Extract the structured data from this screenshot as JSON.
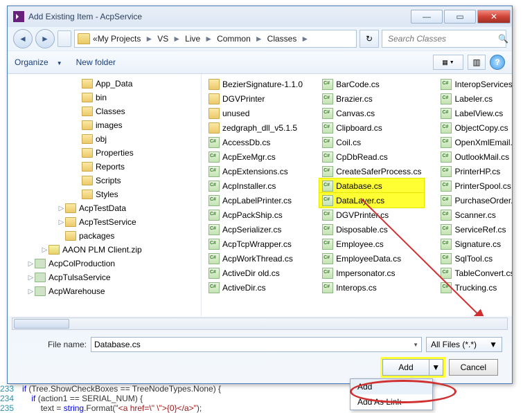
{
  "title": "Add Existing Item - AcpService",
  "breadcrumb": [
    "My Projects",
    "VS",
    "Live",
    "Common",
    "Classes"
  ],
  "search_placeholder": "Search Classes",
  "toolbar": {
    "organize": "Organize",
    "newfolder": "New folder"
  },
  "tree": [
    {
      "d": 3,
      "t": "App_Data"
    },
    {
      "d": 3,
      "t": "bin"
    },
    {
      "d": 3,
      "t": "Classes"
    },
    {
      "d": 3,
      "t": "images"
    },
    {
      "d": 3,
      "t": "obj"
    },
    {
      "d": 3,
      "t": "Properties"
    },
    {
      "d": 3,
      "t": "Reports"
    },
    {
      "d": 3,
      "t": "Scripts"
    },
    {
      "d": 3,
      "t": "Styles"
    },
    {
      "d": 2,
      "t": "AcpTestData",
      "tw": "▷"
    },
    {
      "d": 2,
      "t": "AcpTestService",
      "tw": "▷"
    },
    {
      "d": 2,
      "t": "packages"
    },
    {
      "d": 1,
      "t": "AAON PLM Client.zip",
      "ico": "zip",
      "tw": "▷"
    },
    {
      "d": 0,
      "t": "AcpColProduction",
      "ico": "svc",
      "tw": "▷"
    },
    {
      "d": 0,
      "t": "AcpTulsaService",
      "ico": "svc",
      "tw": "▷"
    },
    {
      "d": 0,
      "t": "AcpWarehouse",
      "ico": "svc",
      "tw": "▷"
    }
  ],
  "files": {
    "col1": [
      {
        "n": "BezierSignature-1.1.0",
        "k": "fldr"
      },
      {
        "n": "DGVPrinter",
        "k": "fldr"
      },
      {
        "n": "unused",
        "k": "fldr"
      },
      {
        "n": "zedgraph_dll_v5.1.5",
        "k": "fldr"
      },
      {
        "n": "AccessDb.cs",
        "k": "cs"
      },
      {
        "n": "AcpExeMgr.cs",
        "k": "cs"
      },
      {
        "n": "AcpExtensions.cs",
        "k": "cs"
      },
      {
        "n": "AcpInstaller.cs",
        "k": "cs"
      },
      {
        "n": "AcpLabelPrinter.cs",
        "k": "cs"
      },
      {
        "n": "AcpPackShip.cs",
        "k": "cs"
      },
      {
        "n": "AcpSerializer.cs",
        "k": "cs"
      },
      {
        "n": "AcpTcpWrapper.cs",
        "k": "cs"
      },
      {
        "n": "AcpWorkThread.cs",
        "k": "cs"
      },
      {
        "n": "ActiveDir old.cs",
        "k": "cs"
      },
      {
        "n": "ActiveDir.cs",
        "k": "cs"
      }
    ],
    "col2": [
      {
        "n": "BarCode.cs",
        "k": "cs"
      },
      {
        "n": "Brazier.cs",
        "k": "cs"
      },
      {
        "n": "Canvas.cs",
        "k": "cs"
      },
      {
        "n": "Clipboard.cs",
        "k": "cs"
      },
      {
        "n": "Coil.cs",
        "k": "cs"
      },
      {
        "n": "CpDbRead.cs",
        "k": "cs"
      },
      {
        "n": "CreateSaferProcess.cs",
        "k": "cs"
      },
      {
        "n": "Database.cs",
        "k": "cs",
        "hl": true
      },
      {
        "n": "DataLayer.cs",
        "k": "cs",
        "hl": true
      },
      {
        "n": "DGVPrinter.cs",
        "k": "cs"
      },
      {
        "n": "Disposable.cs",
        "k": "cs"
      },
      {
        "n": "Employee.cs",
        "k": "cs"
      },
      {
        "n": "EmployeeData.cs",
        "k": "cs"
      },
      {
        "n": "Impersonator.cs",
        "k": "cs"
      },
      {
        "n": "Interops.cs",
        "k": "cs"
      }
    ],
    "col3": [
      {
        "n": "InteropServices.cs",
        "k": "cs"
      },
      {
        "n": "Labeler.cs",
        "k": "cs"
      },
      {
        "n": "LabelView.cs",
        "k": "cs"
      },
      {
        "n": "ObjectCopy.cs",
        "k": "cs"
      },
      {
        "n": "OpenXmlEmail.cs",
        "k": "cs"
      },
      {
        "n": "OutlookMail.cs",
        "k": "cs"
      },
      {
        "n": "PrinterHP.cs",
        "k": "cs"
      },
      {
        "n": "PrinterSpool.cs",
        "k": "cs"
      },
      {
        "n": "PurchaseOrder.cs",
        "k": "cs"
      },
      {
        "n": "Scanner.cs",
        "k": "cs"
      },
      {
        "n": "ServiceRef.cs",
        "k": "cs"
      },
      {
        "n": "Signature.cs",
        "k": "cs"
      },
      {
        "n": "SqlTool.cs",
        "k": "cs"
      },
      {
        "n": "TableConvert.cs",
        "k": "cs"
      },
      {
        "n": "Trucking.cs",
        "k": "cs"
      }
    ]
  },
  "filename": {
    "label": "File name:",
    "value": "Database.cs"
  },
  "filter": "All Files (*.*)",
  "buttons": {
    "add": "Add",
    "cancel": "Cancel"
  },
  "dropdown": {
    "add": "Add",
    "addaslink": "Add As Link"
  },
  "code": {
    "lines": [
      "233",
      "234",
      "235"
    ],
    "l1a": "if",
    "l1b": " (Tree.ShowCheckBoxes == TreeNodeTypes.None) {",
    "l2a": "if",
    "l2b": " (action1 == SERIAL_NUM) {",
    "l3a": "text = ",
    "l3b": "string",
    "l3c": ".Format(",
    "l3d": "\"<a href=\\\" \\\">{0}</a>\"",
    "l3e": ");"
  }
}
